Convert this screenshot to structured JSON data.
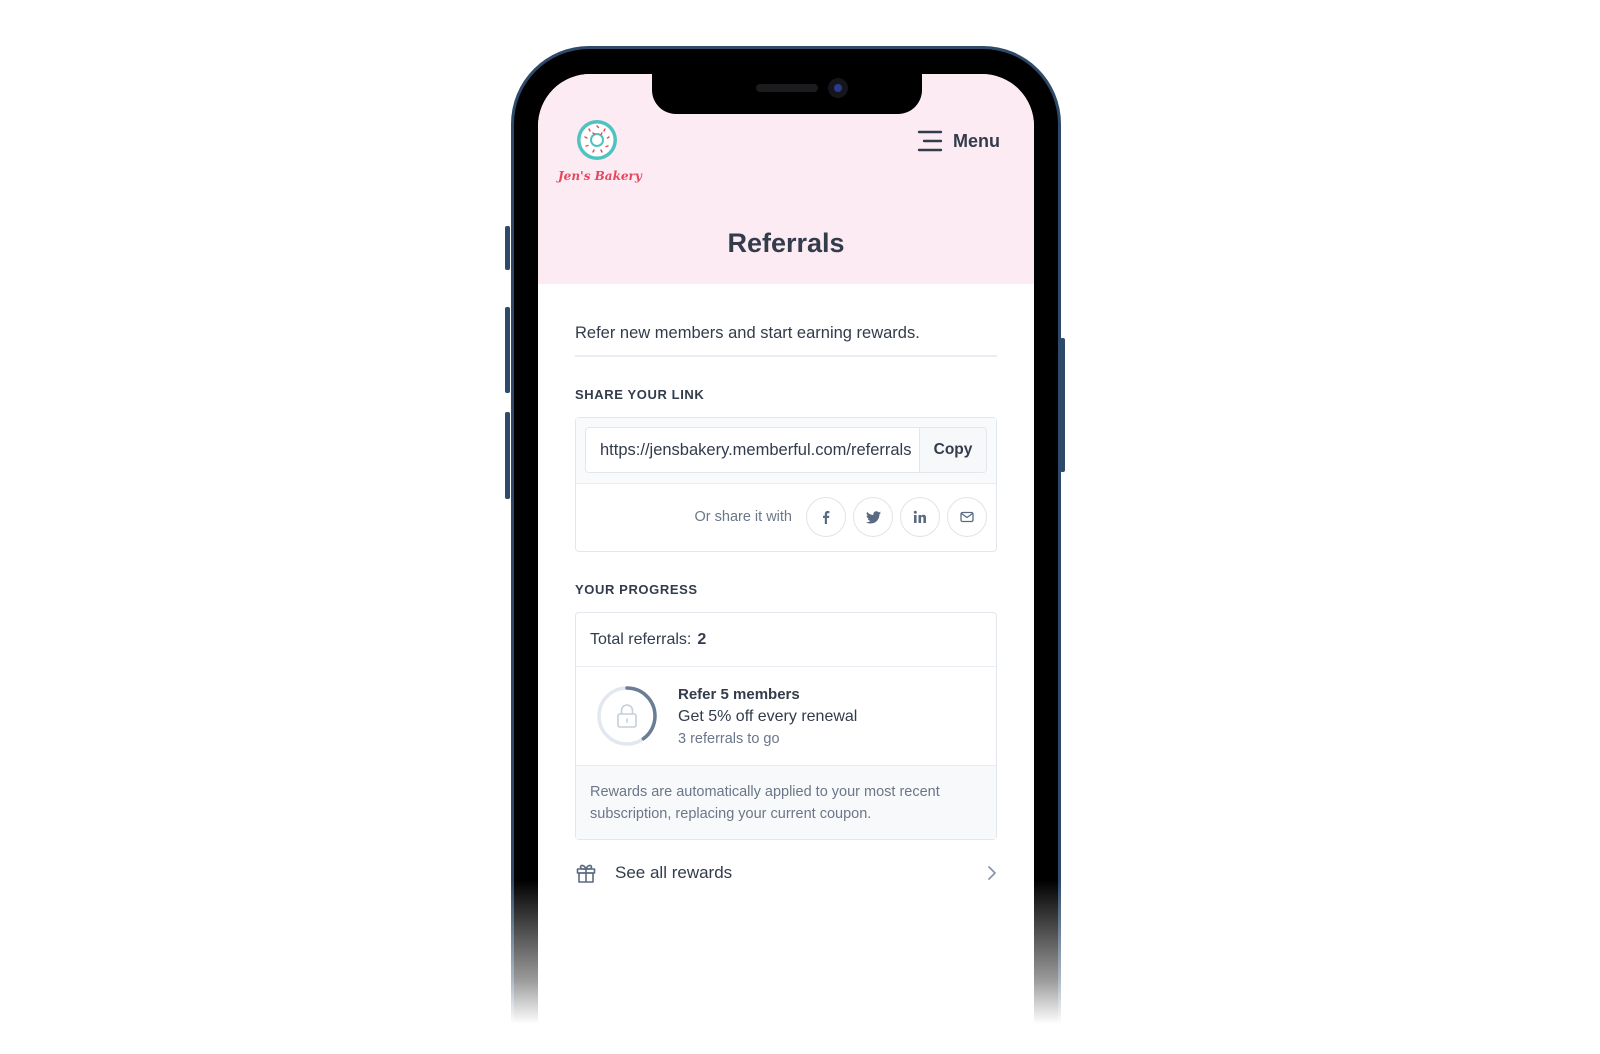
{
  "header": {
    "logo_text": "Jen's Bakery",
    "menu_label": "Menu",
    "page_title": "Referrals"
  },
  "intro_text": "Refer new members and start earning rewards.",
  "share": {
    "section_label": "SHARE YOUR LINK",
    "link_value": "https://jensbakery.memberful.com/referrals",
    "copy_label": "Copy",
    "share_label": "Or share it with",
    "channels": [
      {
        "name": "facebook",
        "icon": "facebook-icon"
      },
      {
        "name": "twitter",
        "icon": "twitter-icon"
      },
      {
        "name": "linkedin",
        "icon": "linkedin-icon"
      },
      {
        "name": "email",
        "icon": "mail-icon"
      }
    ]
  },
  "progress": {
    "section_label": "YOUR PROGRESS",
    "total_label": "Total referrals:",
    "total_value": "2",
    "reward": {
      "title": "Refer 5 members",
      "description": "Get 5% off every renewal",
      "remaining": "3 referrals to go",
      "current": 2,
      "goal": 5,
      "locked": true
    },
    "note": "Rewards are automatically applied to your most recent subscription, replacing your current coupon."
  },
  "see_all_label": "See all rewards",
  "colors": {
    "header_bg": "#fdebf3",
    "brand_pink": "#e5485e",
    "brand_teal": "#4fc3c0",
    "text_primary": "#323c4b",
    "text_muted": "#6b7789",
    "ring_track": "#e3e8ef",
    "ring_fill": "#6a7d94"
  }
}
